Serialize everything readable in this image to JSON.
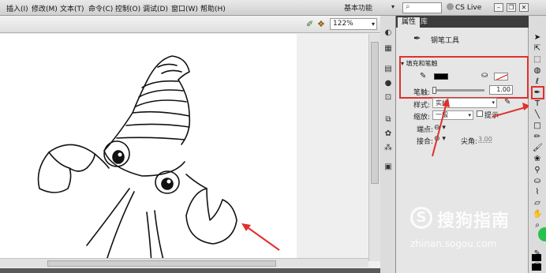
{
  "menubar": {
    "items": [
      "插入(I)",
      "修改(M)",
      "文本(T)",
      "命令(C)",
      "控制(O)",
      "调试(D)",
      "窗口(W)",
      "帮助(H)"
    ],
    "workspace": "基本功能",
    "cs_live": "CS Live"
  },
  "stage": {
    "zoom": "122%"
  },
  "panel": {
    "tabs": [
      "属性",
      "库"
    ],
    "tool_name": "钢笔工具",
    "section_title": "填充和笔触",
    "stroke_label": "笔触:",
    "stroke_value": "1.00",
    "stroke_slider_fraction": 0.0,
    "style_label": "样式:",
    "style_value": "实线",
    "scale_label": "缩放:",
    "scale_value": "一般",
    "hint_label": "提示",
    "cap_label": "端点:",
    "join_label": "接合:",
    "miter_label": "尖角:",
    "miter_value": "3.00",
    "stroke_color": "#000000",
    "fill_color": "none"
  },
  "watermark": {
    "title": "搜狗指南",
    "url": "zhinan.sogou.com"
  },
  "colors": {
    "highlight": "#e0302e"
  }
}
